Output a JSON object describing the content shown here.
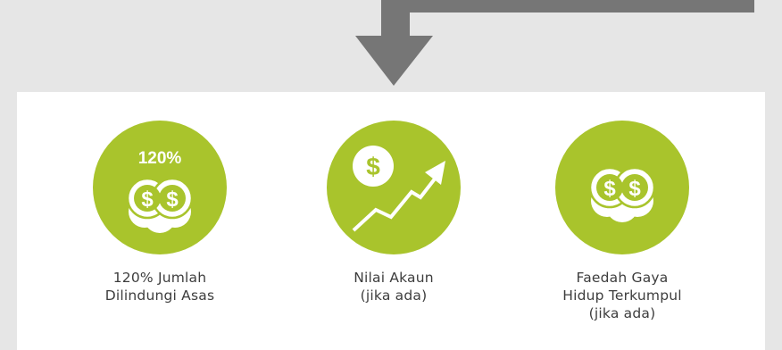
{
  "colors": {
    "accent": "#a9c42c",
    "arrow": "#767676",
    "background": "#e6e6e6",
    "panel": "#ffffff",
    "text": "#3d3d3d"
  },
  "benefits": [
    {
      "icon": "coins-percent-icon",
      "badge": "120%",
      "lines": [
        "120% Jumlah",
        "Dilindungi Asas"
      ]
    },
    {
      "icon": "dollar-growth-icon",
      "lines": [
        "Nilai Akaun",
        "(jika ada)"
      ]
    },
    {
      "icon": "coins-icon",
      "lines": [
        "Faedah Gaya",
        "Hidup Terkumpul",
        "(jika ada)"
      ]
    }
  ]
}
